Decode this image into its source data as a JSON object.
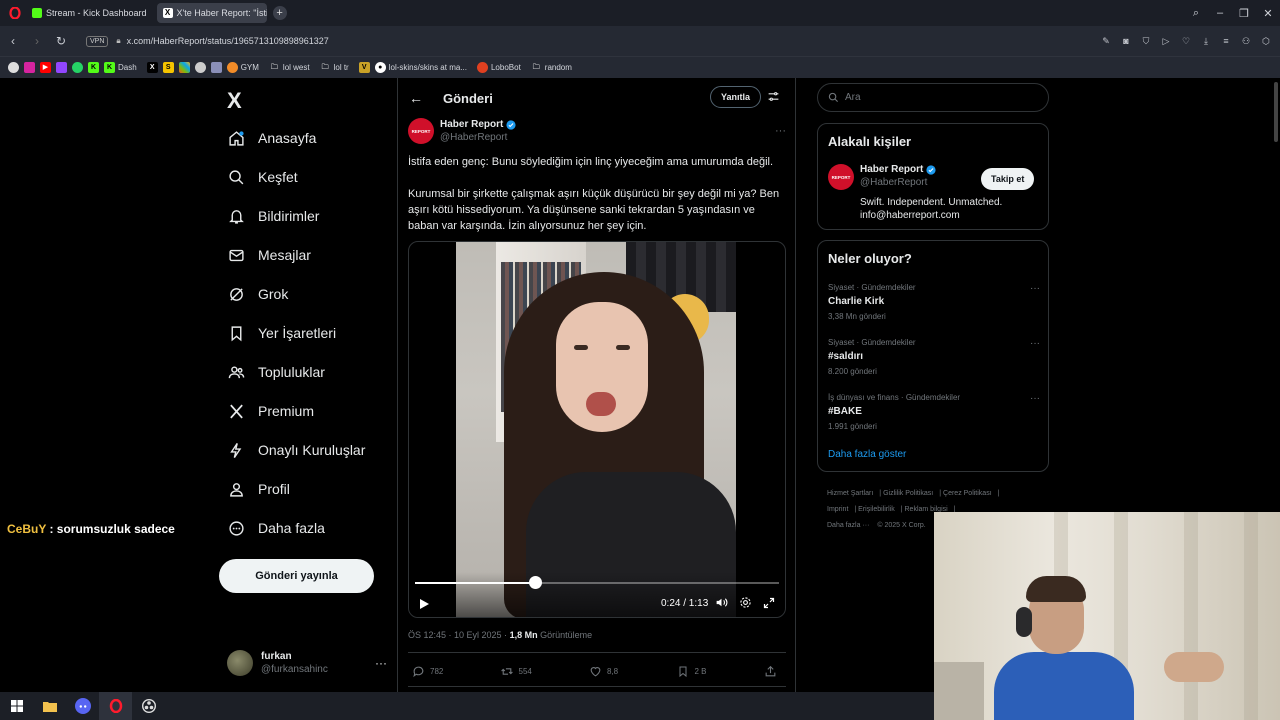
{
  "browser": {
    "tabs": [
      {
        "title": "Stream - Kick Dashboard",
        "active": false
      },
      {
        "title": "X'te Haber Report: \"İstifa",
        "active": true
      }
    ],
    "vpn_label": "VPN",
    "url": "x.com/HaberReport/status/1965713109898961327",
    "bookmarks": [
      {
        "label": "Dash"
      },
      {
        "label": "GYM"
      },
      {
        "label": "lol west"
      },
      {
        "label": "lol tr"
      },
      {
        "label": "lol-skins/skins at ma..."
      },
      {
        "label": "LoboBot"
      },
      {
        "label": "random"
      }
    ]
  },
  "sidebar": {
    "logo": "X",
    "items": [
      {
        "label": "Anasayfa",
        "icon": "home-icon"
      },
      {
        "label": "Keşfet",
        "icon": "search-icon"
      },
      {
        "label": "Bildirimler",
        "icon": "bell-icon"
      },
      {
        "label": "Mesajlar",
        "icon": "mail-icon"
      },
      {
        "label": "Grok",
        "icon": "grok-icon"
      },
      {
        "label": "Yer İşaretleri",
        "icon": "bookmark-icon"
      },
      {
        "label": "Topluluklar",
        "icon": "people-icon"
      },
      {
        "label": "Premium",
        "icon": "x-icon"
      },
      {
        "label": "Onaylı Kuruluşlar",
        "icon": "lightning-icon"
      },
      {
        "label": "Profil",
        "icon": "person-icon"
      },
      {
        "label": "Daha fazla",
        "icon": "more-circle-icon"
      }
    ],
    "post_button": "Gönderi yayınla",
    "user": {
      "name": "furkan",
      "handle": "@furkansahinc"
    }
  },
  "chat": {
    "user": "CeBuY",
    "separator": " : ",
    "message": "sorumsuzluk sadece"
  },
  "post": {
    "header_title": "Gönderi",
    "reply_button": "Yanıtla",
    "author_name": "Haber Report",
    "author_handle": "@HaberReport",
    "avatar_text": "REPORT",
    "text_1": "İstifa eden genç: Bunu söylediğim için linç yiyeceğim ama umurumda değil.",
    "text_2": "Kurumsal bir şirkette çalışmak aşırı küçük düşürücü bir şey değil mi ya? Ben aşırı kötü hissediyorum. Ya düşünsene sanki tekrardan 5 yaşındasın ve baban var karşında. İzin alıyorsunuz her şey için.",
    "video": {
      "current_time": "0:24",
      "duration": "1:13",
      "time_display": "0:24 / 1:13",
      "progress": 0.33
    },
    "timestamp": "ÖS 12:45 · 10 Eyl 2025 · ",
    "views_count": "1,8 Mn",
    "views_label": " Görüntüleme",
    "stats": {
      "replies": "782",
      "reposts": "554",
      "likes": "8,8",
      "bookmarks": "2 B"
    }
  },
  "right": {
    "search_placeholder": "Ara",
    "related_title": "Alakalı kişiler",
    "related": {
      "name": "Haber Report",
      "handle": "@HaberReport",
      "follow_label": "Takip et",
      "bio_1": "Swift. Independent. Unmatched.",
      "bio_2": "info@haberreport.com"
    },
    "trends_title": "Neler oluyor?",
    "trends": [
      {
        "category": "Siyaset · Gündemdekiler",
        "name": "Charlie Kirk",
        "count": "3,38 Mn gönderi"
      },
      {
        "category": "Siyaset · Gündemdekiler",
        "name": "#saldırı",
        "count": "8.200 gönderi"
      },
      {
        "category": "İş dünyası ve finans · Gündemdekiler",
        "name": "#BAKE",
        "count": "1.991 gönderi"
      }
    ],
    "show_more": "Daha fazla göster",
    "footer": [
      "Hizmet Şartları",
      "Gizlilik Politikası",
      "Çerez Politikası",
      "Imprint",
      "Erişilebilirlik",
      "Reklam bilgisi",
      "Daha fazla ···",
      "© 2025 X Corp."
    ]
  },
  "colors": {
    "accent": "#1d9bf0",
    "background": "#000000",
    "border": "#2f3336",
    "muted": "#71767b",
    "haber_red": "#d0102a",
    "chat_user": "#f0c040"
  }
}
